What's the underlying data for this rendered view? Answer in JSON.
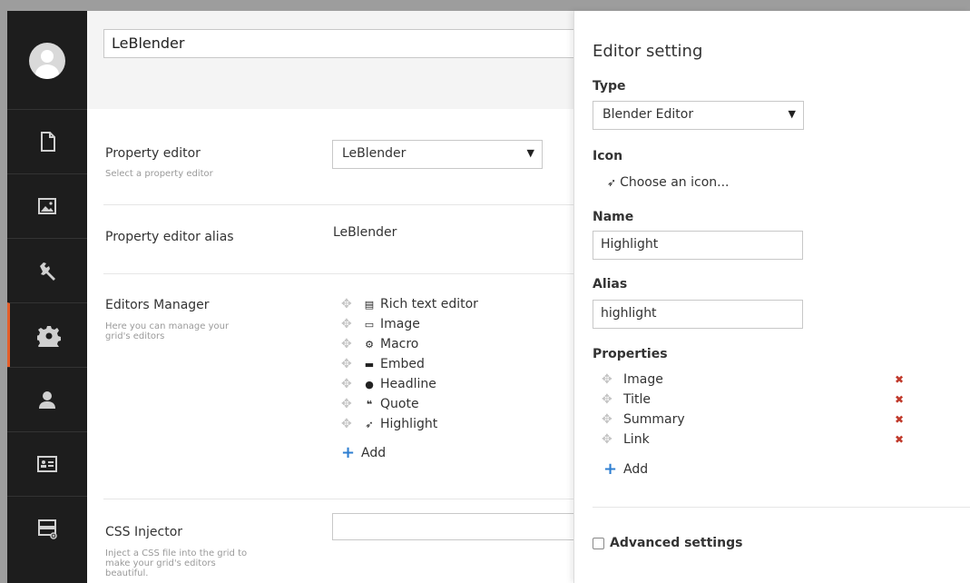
{
  "doc_type_name": "LeBlender",
  "sidebar": {
    "items": [
      {
        "icon": "document-icon"
      },
      {
        "icon": "media-icon"
      },
      {
        "icon": "wrench-icon"
      },
      {
        "icon": "gear-icon",
        "active": true
      },
      {
        "icon": "user-icon"
      },
      {
        "icon": "member-card-icon"
      },
      {
        "icon": "forms-icon"
      }
    ],
    "active_color": "#e45e2a"
  },
  "property_editor": {
    "label": "Property editor",
    "description": "Select a property editor",
    "selected": "LeBlender"
  },
  "alias_row": {
    "label": "Property editor alias",
    "value": "LeBlender"
  },
  "editors_manager": {
    "label": "Editors Manager",
    "description": "Here you can manage your grid's editors",
    "items": [
      {
        "icon": "rte-icon",
        "glyph": "▤",
        "label": "Rich text editor"
      },
      {
        "icon": "picture-icon",
        "glyph": "▭",
        "label": "Image"
      },
      {
        "icon": "macro-icon",
        "glyph": "⚙",
        "label": "Macro"
      },
      {
        "icon": "embed-icon",
        "glyph": "▬",
        "label": "Embed"
      },
      {
        "icon": "headline-icon",
        "glyph": "●",
        "label": "Headline"
      },
      {
        "icon": "quote-icon",
        "glyph": "❝",
        "label": "Quote"
      },
      {
        "icon": "pin-icon",
        "glyph": "➶",
        "label": "Highlight"
      }
    ],
    "add_label": "Add"
  },
  "css_injector": {
    "label": "CSS Injector",
    "description": "Inject a CSS file into the grid to make your grid's editors beautiful."
  },
  "panel": {
    "title": "Editor setting",
    "type_label": "Type",
    "type_value": "Blender Editor",
    "icon_label": "Icon",
    "choose_icon": "Choose an icon...",
    "name_label": "Name",
    "name_value": "Highlight",
    "alias_label": "Alias",
    "alias_value": "highlight",
    "properties_label": "Properties",
    "properties": [
      {
        "label": "Image"
      },
      {
        "label": "Title"
      },
      {
        "label": "Summary"
      },
      {
        "label": "Link"
      }
    ],
    "add_label": "Add",
    "advanced_label": "Advanced settings"
  }
}
